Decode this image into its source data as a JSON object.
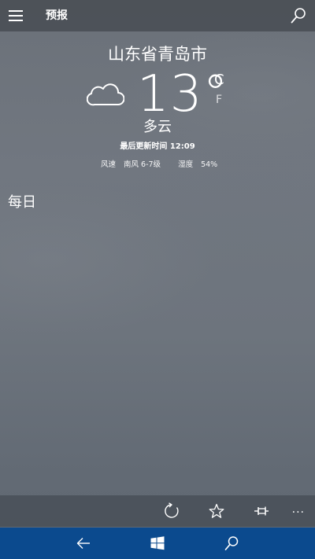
{
  "header": {
    "title": "预报",
    "menu_icon": "hamburger-icon",
    "search_icon": "search-icon"
  },
  "weather": {
    "city": "山东省青岛市",
    "condition_icon": "cloud-icon",
    "temperature": "13°",
    "unit_c": "C",
    "unit_f": "F",
    "condition": "多云",
    "updated": "最后更新时间 12:09",
    "wind_label": "风速",
    "wind_value": "南风 6-7级",
    "humidity_label": "湿度",
    "humidity_value": "54%"
  },
  "section": {
    "daily": "每日"
  },
  "appbar": {
    "refresh_icon": "refresh-icon",
    "favorite_icon": "star-icon",
    "pin_icon": "pin-icon",
    "more_label": "..."
  },
  "system_nav": {
    "back_icon": "back-arrow-icon",
    "start_icon": "windows-logo-icon",
    "search_icon": "search-icon"
  },
  "colors": {
    "sky": "#6d747d",
    "system_nav": "#0b4a8e"
  }
}
